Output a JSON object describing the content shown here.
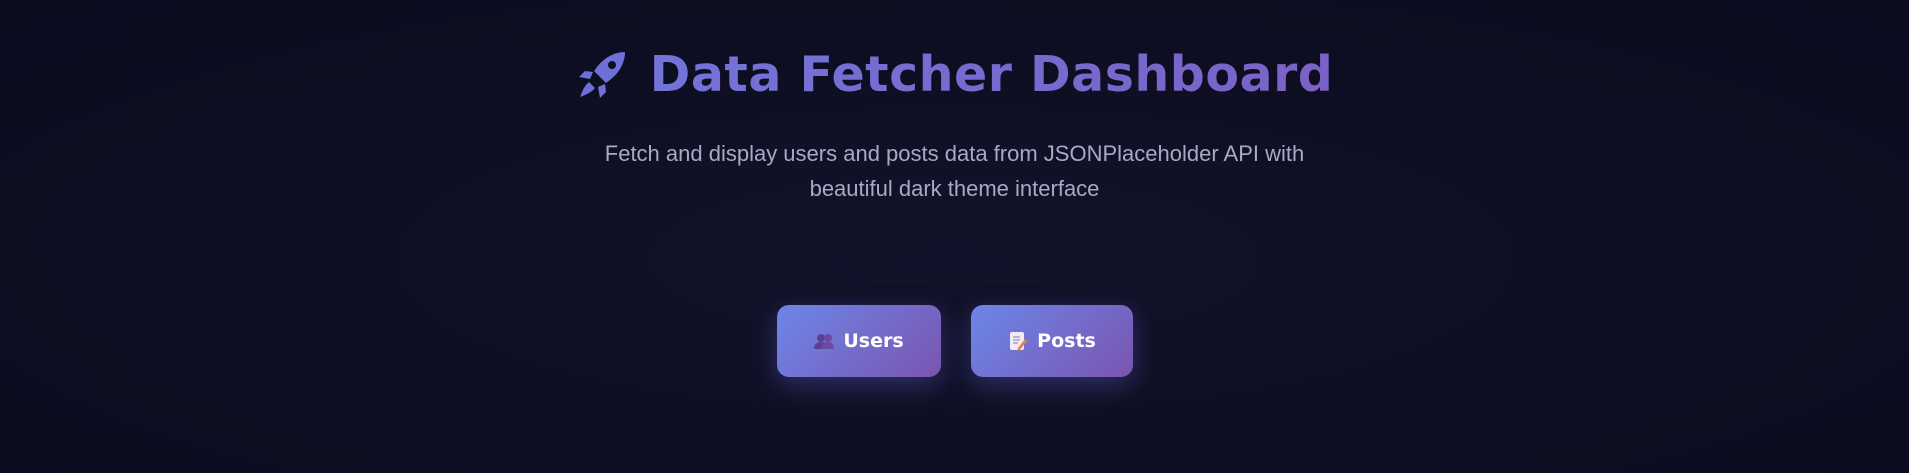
{
  "header": {
    "title": "Data Fetcher Dashboard",
    "icon": "rocket-icon",
    "subtitle": "Fetch and display users and posts data from JSONPlaceholder API with beautiful dark theme interface"
  },
  "nav": {
    "buttons": [
      {
        "label": "Users",
        "icon": "users-icon"
      },
      {
        "label": "Posts",
        "icon": "memo-icon"
      }
    ]
  },
  "colors": {
    "background": "#0f0f23",
    "accent_start": "#6c86e8",
    "accent_end": "#7a55b0",
    "title": "#7b6fd6",
    "subtitle": "#a7a9c6"
  }
}
